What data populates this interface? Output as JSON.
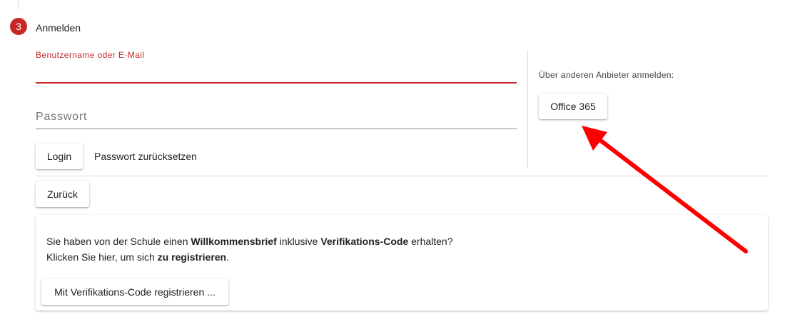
{
  "step": {
    "number": "3",
    "title": "Anmelden"
  },
  "login": {
    "username_label": "Benutzername oder E-Mail",
    "username_value": "",
    "password_placeholder": "Passwort",
    "login_button": "Login",
    "reset_link": "Passwort zurücksetzen",
    "back_button": "Zurück"
  },
  "providers": {
    "label": "Über anderen Anbieter anmelden:",
    "office_button": "Office 365"
  },
  "register": {
    "line1_part1": "Sie haben von der Schule einen ",
    "line1_bold1": "Willkommensbrief",
    "line1_part2": " inklusive ",
    "line1_bold2": "Verifikations-Code",
    "line1_part3": " erhalten?",
    "line2_part1": "Klicken Sie hier, um sich ",
    "line2_bold": "zu registrieren",
    "line2_part2": ".",
    "button": "Mit Verifikations-Code registrieren ..."
  },
  "colors": {
    "accent": "#c62828",
    "annotation_arrow": "#ff0000"
  }
}
